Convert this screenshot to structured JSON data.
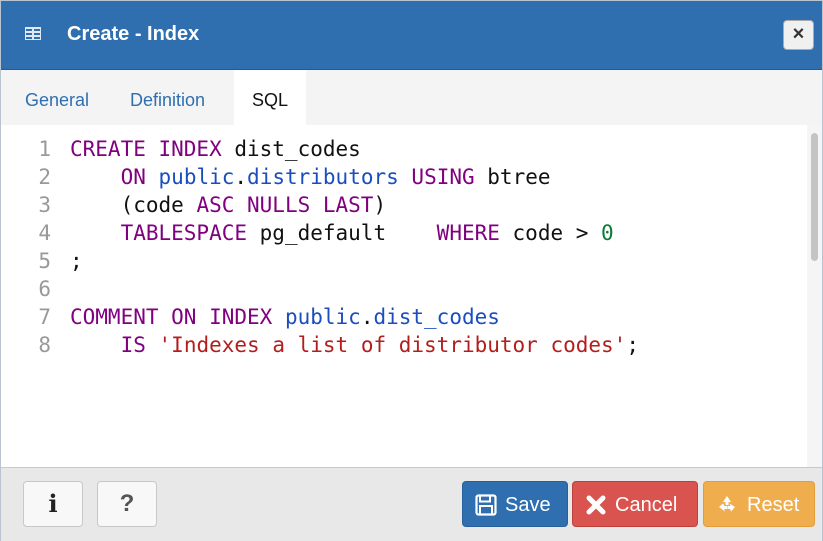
{
  "window": {
    "title": "Create - Index",
    "icon": "index-icon",
    "close_label": "×"
  },
  "tabs": [
    {
      "label": "General",
      "active": false
    },
    {
      "label": "Definition",
      "active": false
    },
    {
      "label": "SQL",
      "active": true
    }
  ],
  "editor": {
    "line_numbers": [
      "1",
      "2",
      "3",
      "4",
      "5",
      "6",
      "7",
      "8"
    ],
    "lines": [
      [
        {
          "t": "CREATE INDEX",
          "c": "kw"
        },
        {
          "t": " dist_codes",
          "c": ""
        }
      ],
      [
        {
          "t": "    ",
          "c": ""
        },
        {
          "t": "ON",
          "c": "kw"
        },
        {
          "t": " ",
          "c": ""
        },
        {
          "t": "public",
          "c": "tb"
        },
        {
          "t": ".",
          "c": ""
        },
        {
          "t": "distributors",
          "c": "tb"
        },
        {
          "t": " ",
          "c": ""
        },
        {
          "t": "USING",
          "c": "kw"
        },
        {
          "t": " btree",
          "c": ""
        }
      ],
      [
        {
          "t": "    (code ",
          "c": ""
        },
        {
          "t": "ASC NULLS LAST",
          "c": "kw"
        },
        {
          "t": ")",
          "c": ""
        }
      ],
      [
        {
          "t": "    ",
          "c": ""
        },
        {
          "t": "TABLESPACE",
          "c": "kw"
        },
        {
          "t": " pg_default    ",
          "c": ""
        },
        {
          "t": "WHERE",
          "c": "kw"
        },
        {
          "t": " code > ",
          "c": ""
        },
        {
          "t": "0",
          "c": "num"
        }
      ],
      [
        {
          "t": ";",
          "c": ""
        }
      ],
      [
        {
          "t": "",
          "c": ""
        }
      ],
      [
        {
          "t": "COMMENT ON INDEX",
          "c": "kw"
        },
        {
          "t": " ",
          "c": ""
        },
        {
          "t": "public",
          "c": "tb"
        },
        {
          "t": ".",
          "c": ""
        },
        {
          "t": "dist_codes",
          "c": "tb"
        }
      ],
      [
        {
          "t": "    ",
          "c": ""
        },
        {
          "t": "IS",
          "c": "kw"
        },
        {
          "t": " ",
          "c": ""
        },
        {
          "t": "'Indexes a list of distributor codes'",
          "c": "str"
        },
        {
          "t": ";",
          "c": ""
        }
      ]
    ]
  },
  "footer": {
    "info_label": "i",
    "help_label": "?",
    "save_label": "Save",
    "cancel_label": "Cancel",
    "reset_label": "Reset"
  },
  "colors": {
    "titlebar": "#2f6fb0",
    "keyword": "#800080",
    "identifier": "#1a4dbf",
    "number": "#0a7a3a",
    "string": "#b31d1d",
    "save": "#2f6fb0",
    "cancel": "#d9534f",
    "reset": "#f0ad4e"
  }
}
